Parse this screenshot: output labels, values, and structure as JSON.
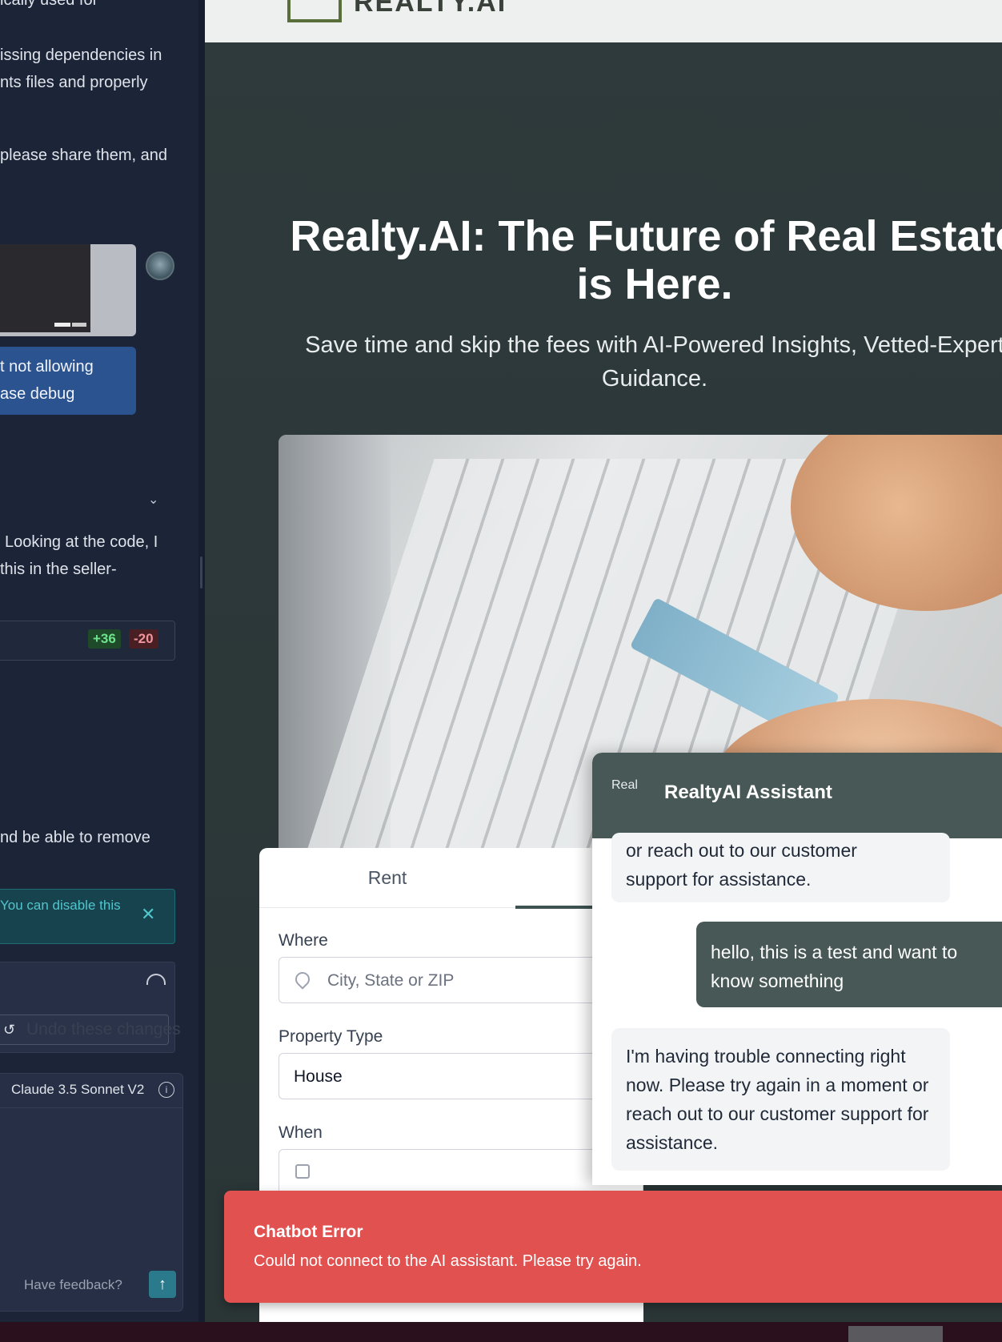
{
  "left_panel": {
    "lines": [
      "ically used for",
      "issing dependencies in",
      "nts files and properly",
      "please share them, and",
      "Looking at the code, I",
      "this in the seller-",
      "nd be able to remove"
    ],
    "user_bubble": "t not allowing\nase debug",
    "diff_plus": "+36",
    "diff_minus": "-20",
    "notice": "You can disable this",
    "undo_label": "Undo these changes",
    "model_label": "Claude 3.5 Sonnet V2",
    "feedback_label": "Have feedback?"
  },
  "site": {
    "logo_text": "REALTY.AI",
    "hero_title": "Realty.AI: The Future of Real Estate is Here.",
    "hero_subtitle": "Save time and skip the fees with AI-Powered Insights, Vetted-Expert Guidance."
  },
  "search": {
    "tab_rent": "Rent",
    "where_label": "Where",
    "where_placeholder": "City, State or ZIP",
    "type_label": "Property Type",
    "type_value": "House",
    "when_label": "When"
  },
  "chatbot": {
    "avatar_alt": "Real",
    "title": "RealtyAI Assistant",
    "msg_partial": "or reach out to our customer\nsupport for assistance.",
    "msg_user": "hello, this is a test and want to know something",
    "msg_bot": "I'm having trouble connecting right now. Please try again in a moment or reach out to our customer support for assistance."
  },
  "toast": {
    "title": "Chatbot Error",
    "message": "Could not connect to the AI assistant. Please try again."
  },
  "colors": {
    "accent": "#475856",
    "error": "#e0514f",
    "panel_bg": "#1c2438"
  }
}
